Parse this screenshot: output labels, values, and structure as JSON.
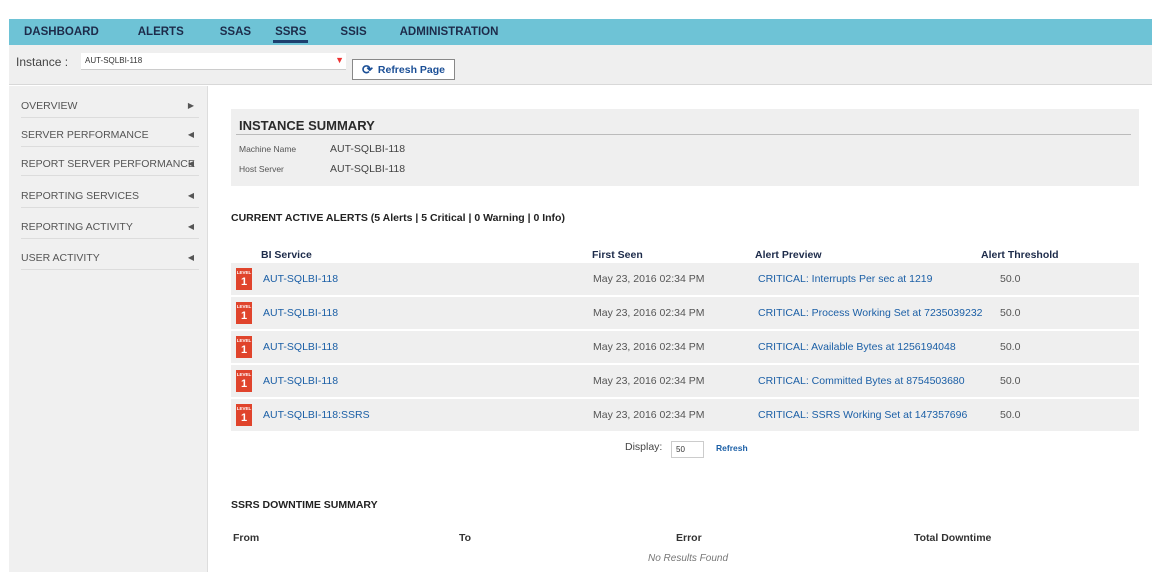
{
  "nav": {
    "items": [
      {
        "label": "DASHBOARD",
        "active": false
      },
      {
        "label": "ALERTS",
        "active": false
      },
      {
        "label": "SSAS",
        "active": false
      },
      {
        "label": "SSRS",
        "active": true
      },
      {
        "label": "SSIS",
        "active": false
      },
      {
        "label": "ADMINISTRATION",
        "active": false
      }
    ]
  },
  "instance": {
    "label": "Instance :",
    "value": "AUT-SQLBI-118",
    "refresh_label": "Refresh Page"
  },
  "sidebar": {
    "items": [
      {
        "label": "OVERVIEW",
        "arrow": "▶"
      },
      {
        "label": "SERVER PERFORMANCE",
        "arrow": "◀"
      },
      {
        "label": "REPORT SERVER PERFORMANCE",
        "arrow": "◀"
      },
      {
        "label": "REPORTING SERVICES",
        "arrow": "◀"
      },
      {
        "label": "REPORTING ACTIVITY",
        "arrow": "◀"
      },
      {
        "label": "USER ACTIVITY",
        "arrow": "◀"
      }
    ]
  },
  "summary": {
    "title": "INSTANCE SUMMARY",
    "machine_label": "Machine Name",
    "machine_value": "AUT-SQLBI-118",
    "host_label": "Host Server",
    "host_value": "AUT-SQLBI-118"
  },
  "alerts": {
    "title": "CURRENT ACTIVE ALERTS (5 Alerts | 5 Critical | 0 Warning | 0 Info)",
    "columns": {
      "service": "BI Service",
      "first_seen": "First Seen",
      "preview": "Alert Preview",
      "threshold": "Alert Threshold"
    },
    "badge_text": "LEVEL",
    "rows": [
      {
        "level": "1",
        "service": "AUT-SQLBI-118",
        "first_seen": "May 23, 2016 02:34 PM",
        "preview": "CRITICAL: Interrupts Per sec at 1219",
        "threshold": "50.0"
      },
      {
        "level": "1",
        "service": "AUT-SQLBI-118",
        "first_seen": "May 23, 2016 02:34 PM",
        "preview": "CRITICAL: Process Working Set at 7235039232",
        "threshold": "50.0"
      },
      {
        "level": "1",
        "service": "AUT-SQLBI-118",
        "first_seen": "May 23, 2016 02:34 PM",
        "preview": "CRITICAL: Available Bytes at 1256194048",
        "threshold": "50.0"
      },
      {
        "level": "1",
        "service": "AUT-SQLBI-118",
        "first_seen": "May 23, 2016 02:34 PM",
        "preview": "CRITICAL: Committed Bytes at 8754503680",
        "threshold": "50.0"
      },
      {
        "level": "1",
        "service": "AUT-SQLBI-118:SSRS",
        "first_seen": "May 23, 2016 02:34 PM",
        "preview": "CRITICAL: SSRS Working Set at 147357696",
        "threshold": "50.0"
      }
    ],
    "display_label": "Display:",
    "display_value": "50",
    "refresh_label": "Refresh"
  },
  "downtime": {
    "title": "SSRS DOWNTIME SUMMARY",
    "columns": {
      "from": "From",
      "to": "To",
      "error": "Error",
      "total": "Total Downtime"
    },
    "empty": "No Results Found"
  },
  "colors": {
    "nav_bg": "#6ec3d6",
    "badge": "#e0442c",
    "link": "#1b5fa6"
  }
}
